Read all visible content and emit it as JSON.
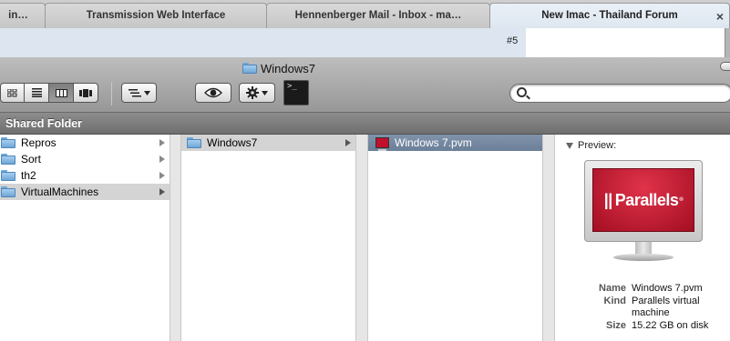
{
  "browser": {
    "tabs": [
      {
        "label": "in…",
        "active": false
      },
      {
        "label": "Transmission Web Interface",
        "active": false
      },
      {
        "label": "Hennenberger Mail - Inbox - ma…",
        "active": false
      },
      {
        "label": "New Imac - Thailand Forum",
        "active": true
      }
    ],
    "close_glyph": "×",
    "page_badge": "#5"
  },
  "finder": {
    "window_title": "Windows7",
    "view_buttons": [
      "icon-view",
      "list-view",
      "column-view",
      "coverflow-view"
    ],
    "active_view": "column-view",
    "search": {
      "value": "",
      "placeholder": ""
    },
    "sidebar_section": "Shared Folder",
    "columns": [
      {
        "items": [
          {
            "label": "Repros",
            "has_children": true,
            "selected": false
          },
          {
            "label": "Sort",
            "has_children": true,
            "selected": false
          },
          {
            "label": "th2",
            "has_children": true,
            "selected": false
          },
          {
            "label": "VirtualMachines",
            "has_children": true,
            "selected": true
          }
        ]
      },
      {
        "items": [
          {
            "label": "Windows7",
            "has_children": true,
            "selected": true
          }
        ]
      },
      {
        "items": [
          {
            "label": "Windows 7.pvm",
            "has_children": false,
            "selected": true
          }
        ]
      }
    ],
    "preview": {
      "heading": "Preview:",
      "logo_text": "Parallels",
      "logo_mark": "||",
      "logo_trademark": "®",
      "info": [
        {
          "key": "Name",
          "value": "Windows 7.pvm"
        },
        {
          "key": "Kind",
          "value": "Parallels virtual machine"
        },
        {
          "key": "Size",
          "value": "15.22 GB on disk"
        }
      ]
    }
  },
  "colors": {
    "selection_blue": "#6b7f99",
    "selection_gray": "#d4d4d4",
    "folder_blue": "#6fa6d6",
    "parallels_red": "#c0102a"
  }
}
